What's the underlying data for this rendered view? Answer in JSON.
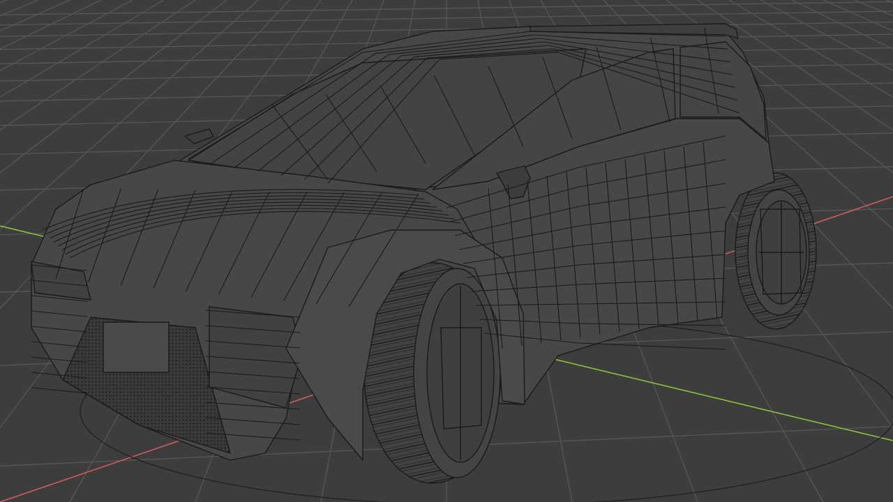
{
  "viewport": {
    "background_color": "#3d3d3d",
    "grid_color": "#575757",
    "x_axis_color": "#d35b62",
    "y_axis_color": "#8fc23c",
    "wire_color": "#1a1a1a",
    "shade_color": "#474747"
  },
  "scene": {
    "object": "car-wireframe-mesh",
    "mode": "wireframe",
    "floor_grid": true
  }
}
